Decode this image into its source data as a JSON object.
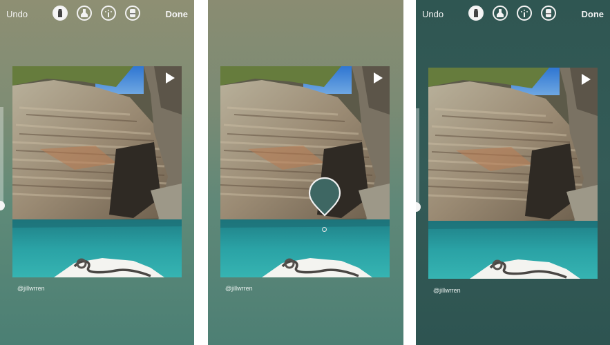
{
  "screens": [
    {
      "undo_label": "Undo",
      "done_label": "Done",
      "username": "@jillwrren",
      "active_tool": "marker"
    },
    {
      "username": "@jillwrren",
      "picker": "eyedropper"
    },
    {
      "undo_label": "Undo",
      "done_label": "Done",
      "username": "@jillwrren",
      "active_tool": "marker"
    }
  ],
  "tools": [
    {
      "name": "marker-icon"
    },
    {
      "name": "highlighter-icon"
    },
    {
      "name": "sparkle-brush-icon"
    },
    {
      "name": "eraser-icon"
    }
  ],
  "colors": {
    "sampled": "#3e6763",
    "screen3_background": "#2f5652",
    "water": "#2f9a9c"
  }
}
